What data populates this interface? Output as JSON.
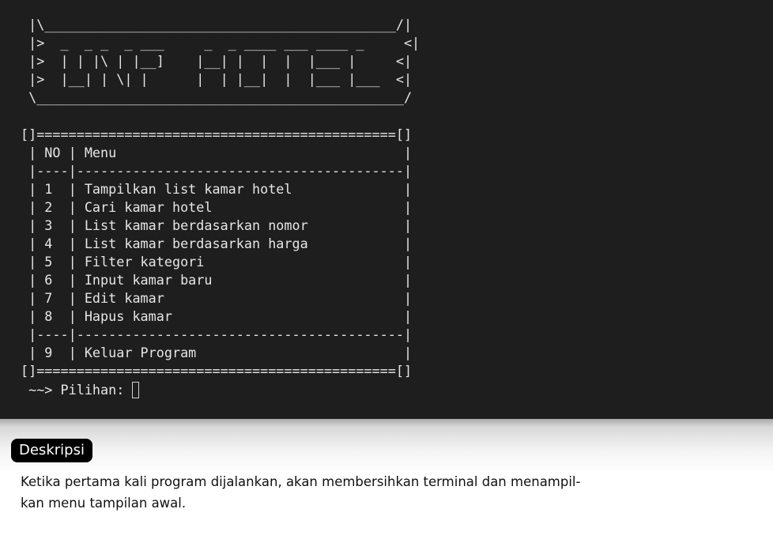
{
  "terminal": {
    "banner": [
      " |\\____________________________________________/|",
      " |>  _  _ _  _ ___     _  _ ____ ___ ____ _     <|",
      " |>  | | |\\ | |__]    |__| |  |  |  |___ |     <|",
      " |>  |__| | \\| |      |  | |__|  |  |___ |___  <|",
      " \\______________________________________________/"
    ],
    "menu_border_top": "[]=============================================[]",
    "menu_header": " | NO | Menu                                    |",
    "menu_separator": " |----|-----------------------------------------|",
    "menu_items": [
      " | 1  | Tampilkan list kamar hotel              |",
      " | 2  | Cari kamar hotel                        |",
      " | 3  | List kamar berdasarkan nomor            |",
      " | 4  | List kamar berdasarkan harga            |",
      " | 5  | Filter kategori                         |",
      " | 6  | Input kamar baru                        |",
      " | 7  | Edit kamar                              |",
      " | 8  | Hapus kamar                             |"
    ],
    "menu_exit": " | 9  | Keluar Program                          |",
    "menu_border_bottom": "[]=============================================[]",
    "prompt": " ~~> Pilihan: "
  },
  "description": {
    "label": "Deskripsi",
    "text": "Ketika pertama kali program dijalankan, akan membersihkan terminal dan menampil-\nkan menu tampilan awal."
  }
}
